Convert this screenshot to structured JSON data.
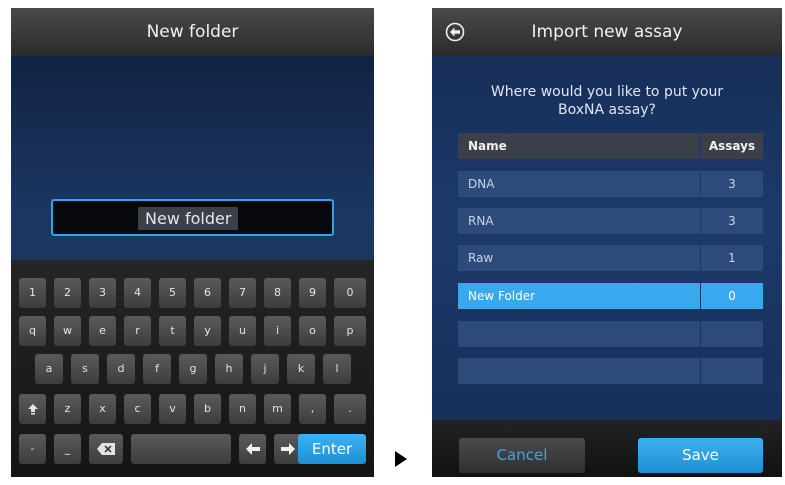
{
  "left": {
    "title": "New folder",
    "input_value": "New folder",
    "keyboard": {
      "row1": [
        "1",
        "2",
        "3",
        "4",
        "5",
        "6",
        "7",
        "8",
        "9",
        "0"
      ],
      "row2": [
        "q",
        "w",
        "e",
        "r",
        "t",
        "y",
        "u",
        "i",
        "o",
        "p"
      ],
      "row3": [
        "a",
        "s",
        "d",
        "f",
        "g",
        "h",
        "j",
        "k",
        "l"
      ],
      "row4": [
        "z",
        "x",
        "c",
        "v",
        "b",
        "n",
        "m",
        ",",
        "."
      ],
      "row5_left": [
        "-",
        "_"
      ],
      "enter_label": "Enter",
      "icons": [
        "shift-icon",
        "backspace-icon",
        "arrow-left-icon",
        "arrow-right-icon"
      ]
    }
  },
  "right": {
    "title": "Import new assay",
    "question": "Where would you like to put your BoxNA assay?",
    "table": {
      "headers": [
        "Name",
        "Assays"
      ],
      "rows": [
        {
          "name": "DNA",
          "assays": "3"
        },
        {
          "name": "RNA",
          "assays": "3"
        },
        {
          "name": "Raw",
          "assays": "1"
        },
        {
          "name": "New Folder",
          "assays": "0"
        },
        {
          "name": "",
          "assays": ""
        },
        {
          "name": "",
          "assays": ""
        }
      ],
      "selected_index": 3
    },
    "cancel_label": "Cancel",
    "save_label": "Save",
    "icons": [
      "back-arrow-circle-icon"
    ]
  },
  "colors": {
    "accent": "#38a8ef",
    "titlebar": "#3a3a3a",
    "background": "#1c3763",
    "row": "#2e4a7a",
    "header_row": "#3b3f48"
  }
}
